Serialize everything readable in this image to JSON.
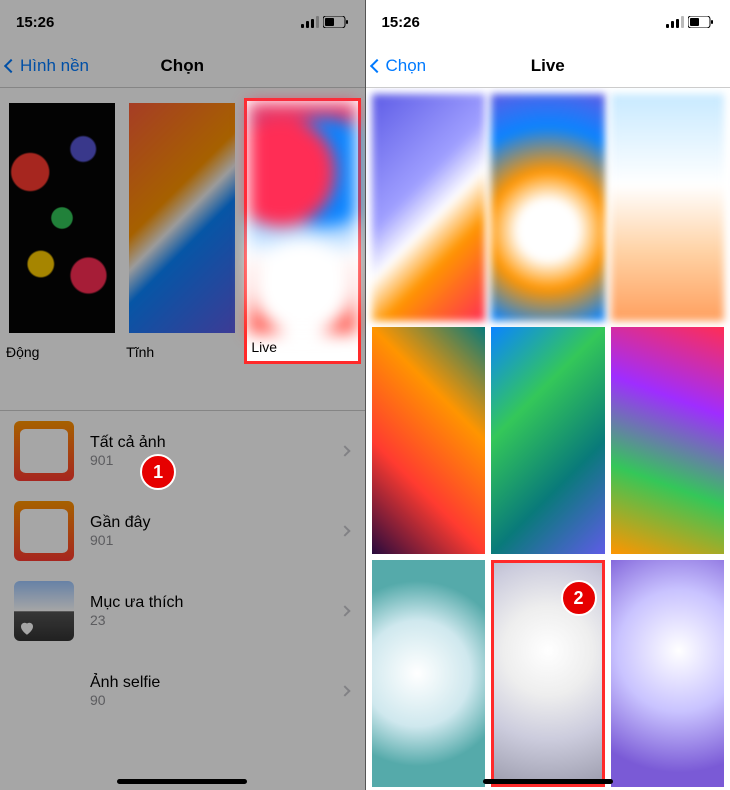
{
  "status": {
    "time": "15:26"
  },
  "left": {
    "nav": {
      "back": "Hình nền",
      "title": "Chọn"
    },
    "categories": [
      {
        "label": "Động"
      },
      {
        "label": "Tĩnh"
      },
      {
        "label": "Live"
      }
    ],
    "badge1": "1",
    "albums": [
      {
        "title": "Tất cả ảnh",
        "count": "901"
      },
      {
        "title": "Gần đây",
        "count": "901"
      },
      {
        "title": "Mục ưa thích",
        "count": "23"
      },
      {
        "title": "Ảnh selfie",
        "count": "90"
      }
    ]
  },
  "right": {
    "nav": {
      "back": "Chọn",
      "title": "Live"
    },
    "badge2": "2"
  }
}
